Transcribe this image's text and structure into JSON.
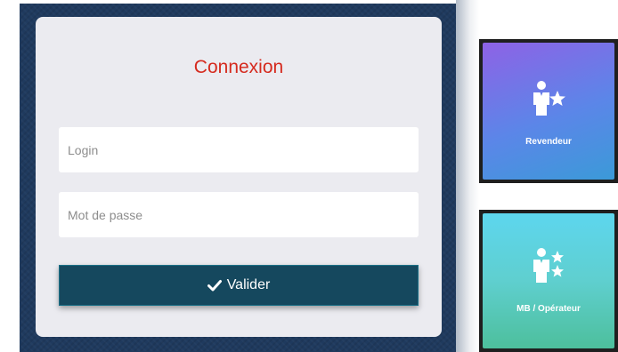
{
  "login": {
    "title": "Connexion",
    "login_placeholder": "Login",
    "password_placeholder": "Mot de passe",
    "submit_label": "Valider",
    "submit_icon": "check-icon"
  },
  "tiles": [
    {
      "label": "Revendeur",
      "icon": "reseller-user-star-icon"
    },
    {
      "label": "MB / Opérateur",
      "icon": "operator-user-stars-icon"
    }
  ],
  "colors": {
    "panel_bg": "#1f3a5e",
    "card_bg": "#ebebf0",
    "title": "#d52a1e",
    "button_bg": "#15485e",
    "reseller_tile_from": "#8e62e6",
    "reseller_tile_to": "#3b9ad8",
    "operator_tile_from": "#5dd6ee",
    "operator_tile_to": "#4dbf9c"
  }
}
